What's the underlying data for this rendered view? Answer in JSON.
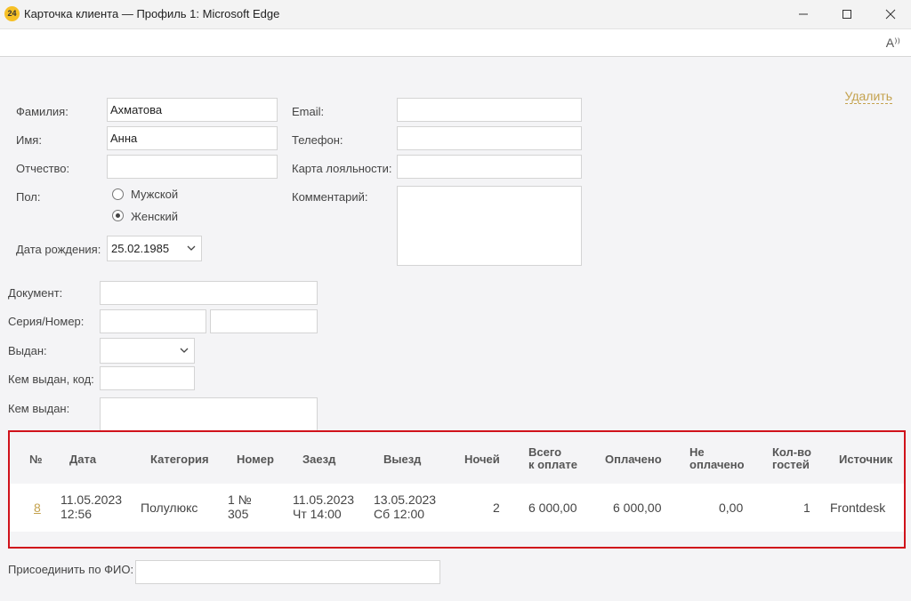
{
  "window": {
    "icon_text": "24",
    "title": "Карточка клиента — Профиль 1: Microsoft Edge"
  },
  "toolbar": {
    "read_aloud_icon": "A⁾⁾"
  },
  "actions": {
    "delete": "Удалить"
  },
  "form": {
    "last_name": {
      "label": "Фамилия:",
      "value": "Ахматова"
    },
    "first_name": {
      "label": "Имя:",
      "value": "Анна"
    },
    "middle_name": {
      "label": "Отчество:",
      "value": ""
    },
    "gender": {
      "label": "Пол:",
      "options": [
        "Мужской",
        "Женский"
      ],
      "selected": "Женский"
    },
    "birth_date": {
      "label": "Дата рождения:",
      "value": "25.02.1985"
    },
    "email": {
      "label": "Email:",
      "value": ""
    },
    "phone": {
      "label": "Телефон:",
      "value": ""
    },
    "loyalty_card": {
      "label": "Карта лояльности:",
      "value": ""
    },
    "comment": {
      "label": "Комментарий:",
      "value": ""
    },
    "document": {
      "label": "Документ:",
      "value": ""
    },
    "series_number": {
      "label": "Серия/Номер:",
      "series": "",
      "number": ""
    },
    "issued": {
      "label": "Выдан:",
      "value": ""
    },
    "issued_by_code": {
      "label": "Кем выдан, код:",
      "value": ""
    },
    "issued_by": {
      "label": "Кем выдан:",
      "value": ""
    }
  },
  "table": {
    "headers": {
      "num": "№",
      "date": "Дата",
      "category": "Категория",
      "room": "Номер",
      "checkin": "Заезд",
      "checkout": "Выезд",
      "nights": "Ночей",
      "total_1": "Всего",
      "total_2": "к оплате",
      "paid": "Оплачено",
      "unpaid_1": "Не",
      "unpaid_2": "оплачено",
      "guests_1": "Кол-во",
      "guests_2": "гостей",
      "source": "Источник"
    },
    "rows": [
      {
        "num": "8",
        "date_1": "11.05.2023",
        "date_2": "12:56",
        "category": "Полулюкс",
        "room_1": "1 №",
        "room_2": "305",
        "checkin_1": "11.05.2023",
        "checkin_2": "Чт 14:00",
        "checkout_1": "13.05.2023",
        "checkout_2": "Сб 12:00",
        "nights": "2",
        "total": "6 000,00",
        "paid": "6 000,00",
        "unpaid": "0,00",
        "guests": "1",
        "source": "Frontdesk"
      }
    ]
  },
  "join": {
    "label": "Присоединить по ФИО:",
    "value": ""
  }
}
